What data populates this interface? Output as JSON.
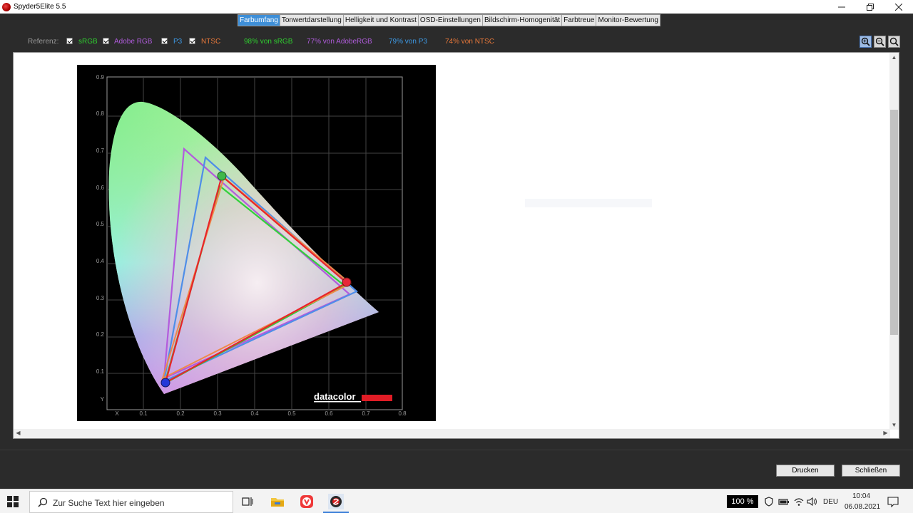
{
  "window": {
    "title": "Spyder5Elite 5.5"
  },
  "tabs": [
    {
      "label": "Farbumfang",
      "active": true
    },
    {
      "label": "Tonwertdarstellung",
      "active": false
    },
    {
      "label": "Helligkeit und Kontrast",
      "active": false
    },
    {
      "label": "OSD-Einstellungen",
      "active": false
    },
    {
      "label": "Bildschirm-Homogenität",
      "active": false
    },
    {
      "label": "Farbtreue",
      "active": false
    },
    {
      "label": "Monitor-Bewertung",
      "active": false
    }
  ],
  "reference": {
    "label": "Referenz:",
    "items": [
      {
        "label": "sRGB",
        "checked": true,
        "color": "#2fcf2f"
      },
      {
        "label": "Adobe RGB",
        "checked": true,
        "color": "#b05cdc"
      },
      {
        "label": "P3",
        "checked": true,
        "color": "#3d9ae6"
      },
      {
        "label": "NTSC",
        "checked": true,
        "color": "#e8783a"
      }
    ],
    "coverage": [
      {
        "text": "98% von sRGB",
        "color": "#2fcf2f"
      },
      {
        "text": "77% von AdobeRGB",
        "color": "#b05cdc"
      },
      {
        "text": "79% von P3",
        "color": "#3d9ae6"
      },
      {
        "text": "74% von NTSC",
        "color": "#e8783a"
      }
    ]
  },
  "zoom_buttons": [
    {
      "icon": "zoom-in-icon"
    },
    {
      "icon": "zoom-out-icon"
    },
    {
      "icon": "zoom-fit-icon"
    }
  ],
  "chart": {
    "x_ticks": [
      "X",
      "0.1",
      "0.2",
      "0.3",
      "0.4",
      "0.5",
      "0.6",
      "0.7",
      "0.8"
    ],
    "y_ticks": [
      "Y",
      "0.1",
      "0.2",
      "0.3",
      "0.4",
      "0.5",
      "0.6",
      "0.7",
      "0.8",
      "0.9"
    ],
    "logo": "datacolor"
  },
  "buttons": {
    "print": "Drucken",
    "close": "Schließen"
  },
  "taskbar": {
    "search_placeholder": "Zur Suche Text hier eingeben",
    "zoom": "100 %",
    "language": "DEU",
    "time": "10:04",
    "date": "06.08.2021"
  }
}
